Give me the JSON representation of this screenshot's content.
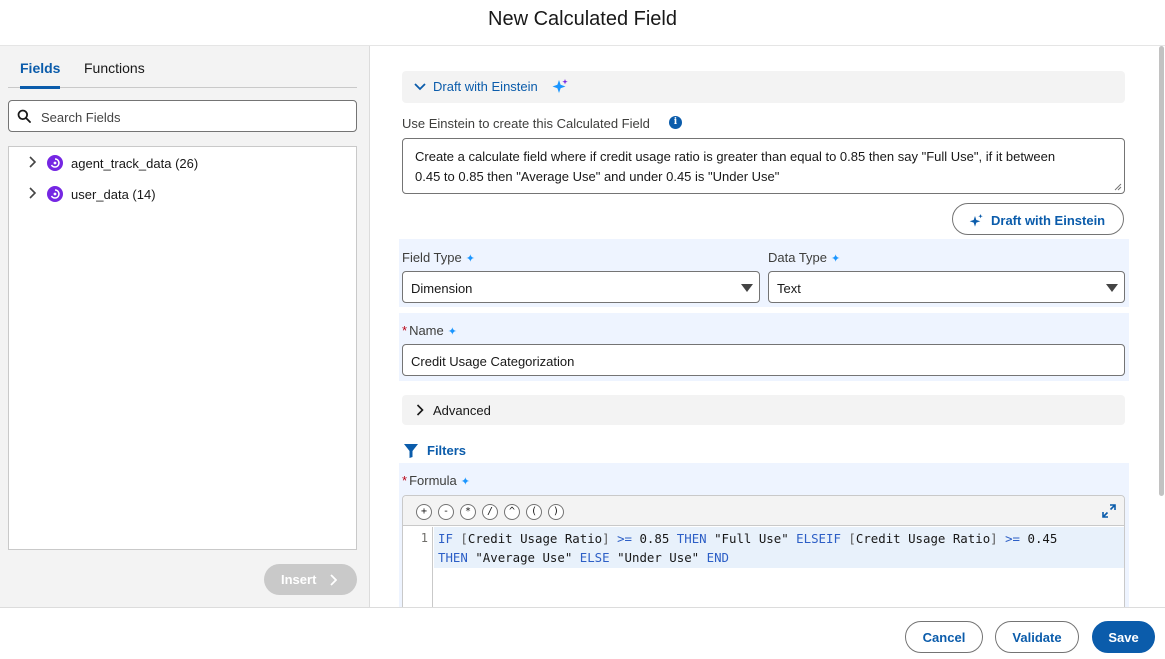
{
  "dialog": {
    "title": "New Calculated Field"
  },
  "left_panel": {
    "tabs": [
      {
        "label": "Fields",
        "active": true
      },
      {
        "label": "Functions",
        "active": false
      }
    ],
    "search": {
      "placeholder": "Search Fields",
      "value": ""
    },
    "tree": [
      {
        "label": "agent_track_data (26)",
        "icon": "data-object-icon"
      },
      {
        "label": "user_data (14)",
        "icon": "data-object-icon"
      }
    ],
    "insert_label": "Insert"
  },
  "einstein": {
    "section_label": "Draft with Einstein",
    "intro": "Use Einstein to create this Calculated Field",
    "info_glyph": "i",
    "prompt_line1": "Create a calculate field where if credit usage ratio is greater than equal to 0.85 then say \"Full Use\", if it between",
    "prompt_line2": "0.45 to 0.85 then \"Average Use\" and under 0.45 is \"Under Use\"",
    "draft_button": "Draft with Einstein"
  },
  "form": {
    "field_type": {
      "label": "Field Type",
      "value": "Dimension"
    },
    "data_type": {
      "label": "Data Type",
      "value": "Text"
    },
    "name": {
      "label": "Name",
      "value": "Credit Usage Categorization",
      "required_mark": "*"
    },
    "advanced_label": "Advanced",
    "filters_label": "Filters",
    "formula": {
      "label": "Formula",
      "required_mark": "*"
    },
    "sparkle": "✦"
  },
  "editor": {
    "operators": [
      "+",
      "-",
      "*",
      "/",
      "^",
      "(",
      ")"
    ],
    "line_number": "1",
    "line1": {
      "t1": "IF",
      "t2": "[",
      "t3": "Credit Usage Ratio",
      "t4": "]",
      "t5": ">=",
      "t6": "0.85",
      "t7": "THEN",
      "t8": "\"Full Use\"",
      "t9": "ELSEIF",
      "t10": "[",
      "t11": "Credit Usage Ratio",
      "t12": "]",
      "t13": ">=",
      "t14": "0.45"
    },
    "line2": {
      "t1": "THEN",
      "t2": "\"Average Use\"",
      "t3": "ELSE",
      "t4": "\"Under Use\"",
      "t5": "END"
    }
  },
  "footer": {
    "cancel": "Cancel",
    "validate": "Validate",
    "save": "Save"
  },
  "colors": {
    "brand": "#0b5cab",
    "einstein_purple": "#7526e3",
    "sparkle_blue": "#1b96ff",
    "required_red": "#ba0517"
  }
}
